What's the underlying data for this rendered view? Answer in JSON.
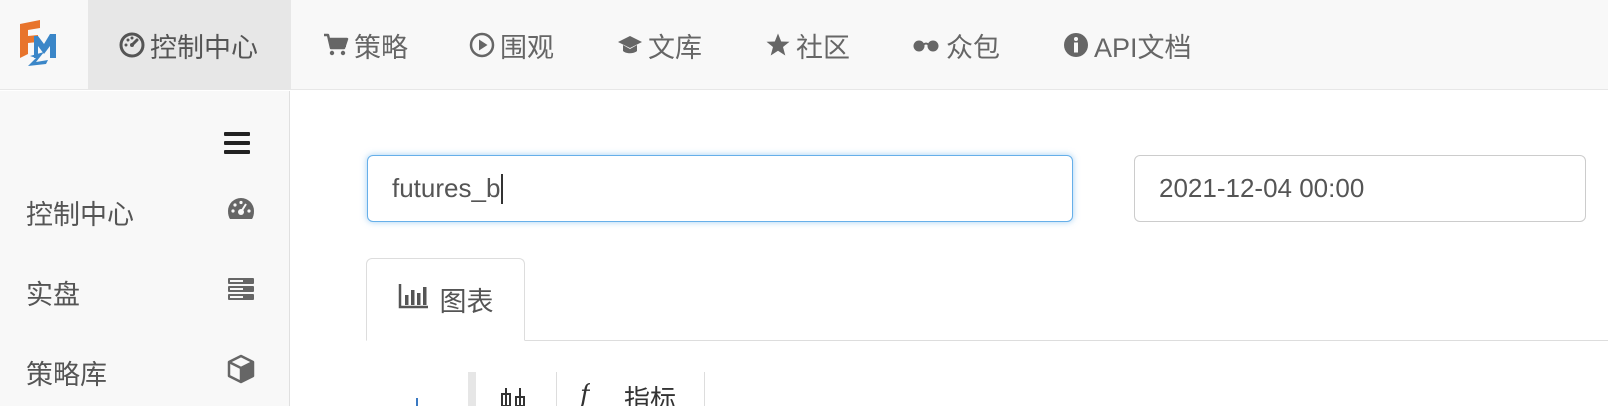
{
  "brand": {
    "logo_text": "FMZ",
    "colors": {
      "orange": "#e8742c",
      "blue": "#3a86c8"
    }
  },
  "topnav": [
    {
      "label": "控制中心",
      "icon": "dashboard-icon",
      "active": true
    },
    {
      "label": "策略",
      "icon": "shopping-cart-icon",
      "active": false
    },
    {
      "label": "围观",
      "icon": "play-circle-icon",
      "active": false
    },
    {
      "label": "文库",
      "icon": "graduation-cap-icon",
      "active": false
    },
    {
      "label": "社区",
      "icon": "star-icon",
      "active": false
    },
    {
      "label": "众包",
      "icon": "glasses-icon",
      "active": false
    },
    {
      "label": "API文档",
      "icon": "info-circle-icon",
      "active": false
    }
  ],
  "sidebar": {
    "toggle_icon": "hamburger-menu-icon",
    "items": [
      {
        "label": "控制中心",
        "icon": "dashboard-icon"
      },
      {
        "label": "实盘",
        "icon": "server-icon"
      },
      {
        "label": "策略库",
        "icon": "cube-icon"
      }
    ]
  },
  "main": {
    "search_input": {
      "value": "futures_b"
    },
    "date_input": {
      "value": "2021-12-04 00:00"
    },
    "tabs": [
      {
        "label": "图表",
        "icon": "bar-chart-icon",
        "active": true
      }
    ],
    "chart_toolbar": {
      "candle_icon": "candlestick-icon",
      "indicator_prefix": "f",
      "indicator_label": "指标"
    }
  }
}
